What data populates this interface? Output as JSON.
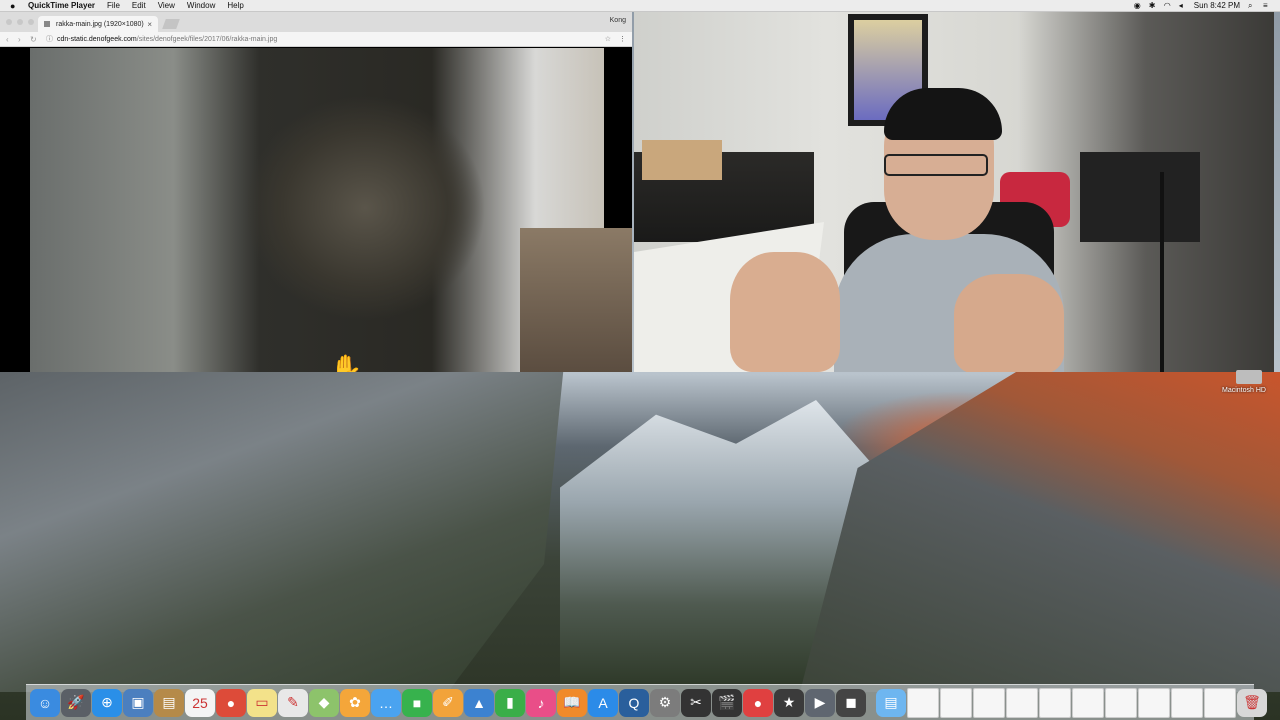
{
  "menubar": {
    "app": "QuickTime Player",
    "items": [
      "File",
      "Edit",
      "View",
      "Window",
      "Help"
    ],
    "clock": "Sun 8:42 PM"
  },
  "browser": {
    "tab_title": "rakka-main.jpg (1920×1080)",
    "profile": "Kong",
    "url_host": "cdn-static.denofgeek.com",
    "url_path": "/sites/denofgeek/files/2017/06/rakka-main.jpg"
  },
  "desktop": {
    "hd_label": "Macintosh HD"
  },
  "dock": {
    "apps": [
      {
        "name": "finder-icon",
        "glyph": "☺",
        "color": "#3a8be0"
      },
      {
        "name": "launchpad-icon",
        "glyph": "🚀",
        "color": "#5a5f66"
      },
      {
        "name": "safari-icon",
        "glyph": "⊕",
        "color": "#2a8fe8"
      },
      {
        "name": "preview-icon",
        "glyph": "▣",
        "color": "#4b7fbf"
      },
      {
        "name": "notes-icon",
        "glyph": "▤",
        "color": "#b58a49"
      },
      {
        "name": "calendar-icon",
        "glyph": "25",
        "color": "#f4f4f4"
      },
      {
        "name": "chrome-icon",
        "glyph": "●",
        "color": "#dd4b39"
      },
      {
        "name": "stickies-icon",
        "glyph": "▭",
        "color": "#f3e28a"
      },
      {
        "name": "textedit-icon",
        "glyph": "✎",
        "color": "#e8e8e8"
      },
      {
        "name": "maps-icon",
        "glyph": "◆",
        "color": "#8dc36b"
      },
      {
        "name": "photos-icon",
        "glyph": "✿",
        "color": "#f4a63a"
      },
      {
        "name": "messages-icon",
        "glyph": "…",
        "color": "#4aa3f0"
      },
      {
        "name": "facetime-icon",
        "glyph": "■",
        "color": "#37b24d"
      },
      {
        "name": "pages-icon",
        "glyph": "✐",
        "color": "#f2a33a"
      },
      {
        "name": "keynote-icon",
        "glyph": "▲",
        "color": "#3c82d0"
      },
      {
        "name": "numbers-icon",
        "glyph": "▮",
        "color": "#3aae48"
      },
      {
        "name": "itunes-icon",
        "glyph": "♪",
        "color": "#e94e88"
      },
      {
        "name": "ibooks-icon",
        "glyph": "📖",
        "color": "#f08a2a"
      },
      {
        "name": "appstore-icon",
        "glyph": "A",
        "color": "#2b8be8"
      },
      {
        "name": "quicktime-icon",
        "glyph": "Q",
        "color": "#2a5f9c"
      },
      {
        "name": "system-prefs-icon",
        "glyph": "⚙",
        "color": "#7c7c7c"
      },
      {
        "name": "final-cut-icon",
        "glyph": "✂",
        "color": "#333"
      },
      {
        "name": "clapper-icon",
        "glyph": "🎬",
        "color": "#333"
      },
      {
        "name": "record-icon",
        "glyph": "●",
        "color": "#e04040"
      },
      {
        "name": "imovie-icon",
        "glyph": "★",
        "color": "#3b3b3b"
      },
      {
        "name": "automator-icon",
        "glyph": "▶",
        "color": "#5f6670"
      },
      {
        "name": "hat-icon",
        "glyph": "◼",
        "color": "#444"
      }
    ],
    "docs": [
      {
        "name": "downloads-folder-icon",
        "glyph": "▤",
        "color": "#6eb6f0"
      },
      {
        "name": "document-icon-1",
        "glyph": "",
        "color": "#f6f6f6"
      },
      {
        "name": "document-icon-2",
        "glyph": "",
        "color": "#f6f6f6"
      },
      {
        "name": "document-icon-3",
        "glyph": "",
        "color": "#f6f6f6"
      },
      {
        "name": "document-icon-4",
        "glyph": "",
        "color": "#f6f6f6"
      },
      {
        "name": "document-icon-5",
        "glyph": "",
        "color": "#f6f6f6"
      },
      {
        "name": "document-icon-6",
        "glyph": "",
        "color": "#f6f6f6"
      },
      {
        "name": "document-icon-7",
        "glyph": "",
        "color": "#f6f6f6"
      },
      {
        "name": "document-icon-8",
        "glyph": "",
        "color": "#f6f6f6"
      },
      {
        "name": "document-icon-9",
        "glyph": "",
        "color": "#f6f6f6"
      },
      {
        "name": "document-icon-10",
        "glyph": "",
        "color": "#f6f6f6"
      },
      {
        "name": "trash-icon",
        "glyph": "🗑",
        "color": "#d8d8d8"
      }
    ]
  }
}
